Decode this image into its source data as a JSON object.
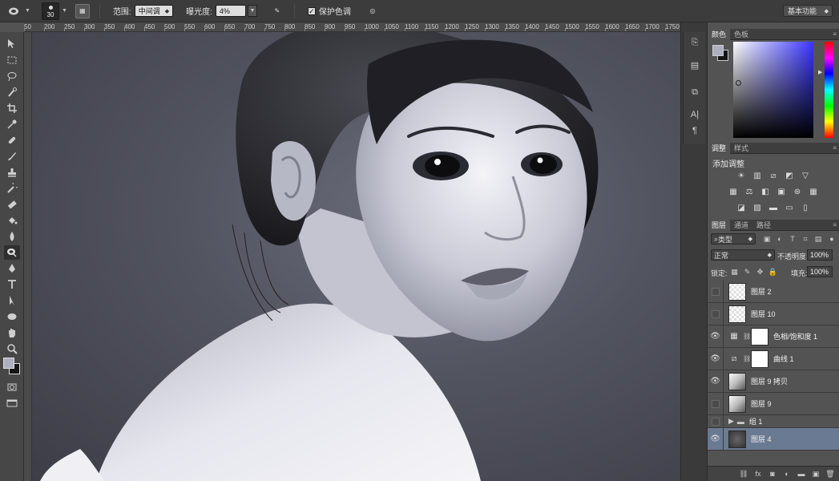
{
  "options_bar": {
    "brush_size": "30",
    "range_label": "范围:",
    "range_value": "中间调",
    "exposure_label": "曝光度:",
    "exposure_value": "4%",
    "protect_tones_label": "保护色调",
    "protect_tones_checked": true,
    "workspace": "基本功能"
  },
  "ruler": {
    "ticks": [
      "50",
      "200",
      "250",
      "300",
      "350",
      "400",
      "450",
      "500",
      "550",
      "600",
      "650",
      "700",
      "750",
      "800",
      "850",
      "900",
      "950",
      "1000",
      "1050",
      "1100",
      "1150",
      "1200",
      "1250",
      "1300",
      "1350",
      "1400",
      "1450",
      "1500",
      "1550",
      "1600",
      "1650",
      "1700",
      "1750",
      "18"
    ]
  },
  "color_panel": {
    "tabs": [
      "颜色",
      "色板"
    ],
    "foreground": "#aeb0c0",
    "background": "#151515"
  },
  "adjustments_panel": {
    "tabs": [
      "调整",
      "样式"
    ],
    "title": "添加调整"
  },
  "layers_panel": {
    "tabs": [
      "图层",
      "通道",
      "路径"
    ],
    "filter_kind": "类型",
    "blend_mode": "正常",
    "opacity_label": "不透明度:",
    "opacity_value": "100%",
    "lock_label": "锁定:",
    "fill_label": "填充:",
    "fill_value": "100%",
    "layers": [
      {
        "name": "图层 2",
        "visible": false,
        "kind": "transparent"
      },
      {
        "name": "图层 10",
        "visible": false,
        "kind": "transparent"
      },
      {
        "name": "色相/饱和度 1",
        "visible": true,
        "kind": "adjustment"
      },
      {
        "name": "曲线 1",
        "visible": true,
        "kind": "adjustment"
      },
      {
        "name": "图层 9 拷贝",
        "visible": true,
        "kind": "photo"
      },
      {
        "name": "图层 9",
        "visible": false,
        "kind": "photo"
      },
      {
        "name": "组 1",
        "visible": false,
        "kind": "group"
      },
      {
        "name": "图层 4",
        "visible": true,
        "kind": "dark",
        "selected": true
      }
    ]
  },
  "colors": {
    "accent_selected_layer": "#6b7a93",
    "ui_dark": "#3c3c3c",
    "ui_panel": "#535353"
  }
}
